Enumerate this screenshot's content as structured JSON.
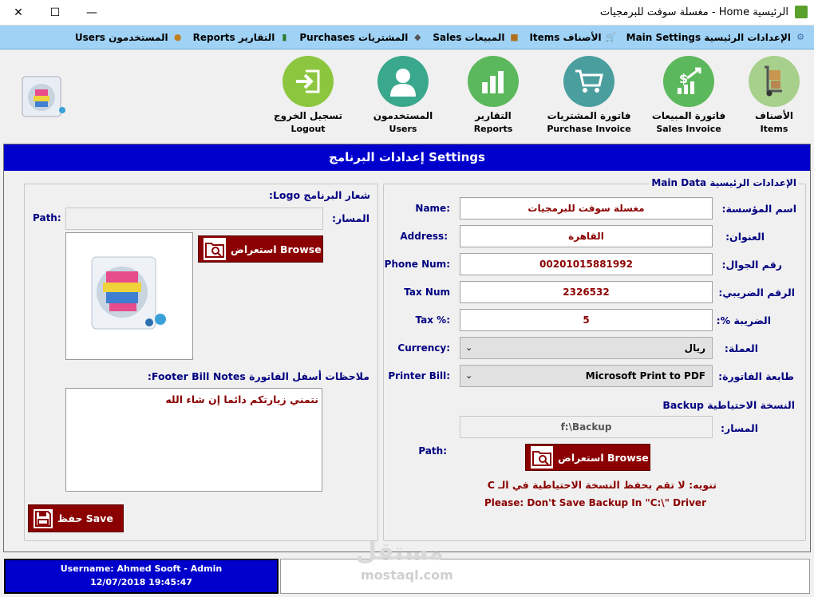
{
  "window": {
    "title": "الرئيسية Home - مغسلة سوفت للبرمجيات",
    "minimize": "—",
    "maximize": "☐",
    "close": "✕"
  },
  "menu": [
    {
      "label": "الإعدادات الرئيسية Main Settings",
      "icon": "gear-icon"
    },
    {
      "label": "الأصناف Items",
      "icon": "cart-icon"
    },
    {
      "label": "المبيعات Sales",
      "icon": "box-icon"
    },
    {
      "label": "المشتريات Purchases",
      "icon": "truck-icon"
    },
    {
      "label": "التقارير Reports",
      "icon": "chart-icon"
    },
    {
      "label": "المستخدمون Users",
      "icon": "users-icon"
    }
  ],
  "toolbar": {
    "items": {
      "ar": "الأصناف",
      "en": "Items"
    },
    "sales": {
      "ar": "فاتورة المبيعات",
      "en": "Sales Invoice"
    },
    "purchase": {
      "ar": "فاتورة المشتريات",
      "en": "Purchase Invoice"
    },
    "reports": {
      "ar": "التقارير",
      "en": "Reports"
    },
    "users": {
      "ar": "المستخدمون",
      "en": "Users"
    },
    "logout": {
      "ar": "تسجيل الخروج",
      "en": "Logout"
    }
  },
  "settings": {
    "header": "إعدادات البرنامج Settings",
    "main_data_title": "الإعدادات الرئيسية Main Data",
    "fields": {
      "name": {
        "ar": "اسم المؤسسة:",
        "en": "Name:",
        "value": "مغسلة سوفت للبرمجيات"
      },
      "address": {
        "ar": "العنوان:",
        "en": "Address:",
        "value": "القاهرة"
      },
      "phone": {
        "ar": "رقم الجوال:",
        "en": "Phone Num:",
        "value": "00201015881992"
      },
      "taxnum": {
        "ar": "الرقم الضريبي:",
        "en": "Tax Num",
        "value": "2326532"
      },
      "tax": {
        "ar": "الضريبة %:",
        "en": "Tax %:",
        "value": "5"
      },
      "currency": {
        "ar": "العملة:",
        "en": "Currency:",
        "value": "ريال"
      },
      "printer": {
        "ar": "طابعة الفاتورة:",
        "en": "Printer Bill:",
        "value": "Microsoft Print to PDF"
      }
    },
    "backup": {
      "title": "النسخة الاحتياطية Backup",
      "path_ar": "المسار:",
      "path_value": "f:\\Backup",
      "path_en": "Path:",
      "browse": "استعراض Browse",
      "note_ar": "تنويه: لا تقم بحفظ النسخة الاحتياطية في الـ C",
      "note_en": "Please: Don't Save Backup In \"C:\\\" Driver"
    },
    "logo": {
      "title": "شعار البرنامج Logo:",
      "path_en": "Path:",
      "path_ar": "المسار:",
      "path_value": "",
      "browse": "استعراض Browse"
    },
    "footer": {
      "title": "ملاحظات أسفل الفاتورة Footer Bill Notes:",
      "text": "نتمني زيارتكم دائما إن شاء الله"
    },
    "save": "حفظ Save"
  },
  "status": {
    "user": "Username: Ahmed Sooft - Admin",
    "datetime": "12/07/2018 19:45:47"
  },
  "watermark": {
    "main": "مستقل",
    "sub": "mostaql.com"
  },
  "colors": {
    "header_blue": "#0000cc",
    "menu_bg": "#9fd2f5",
    "button_red": "#8b0000",
    "tool_green": "#5cb85c"
  }
}
